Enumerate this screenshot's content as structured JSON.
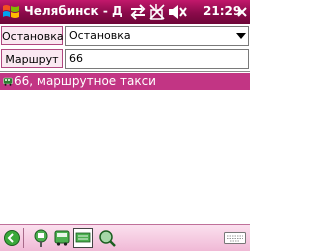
{
  "window": {
    "title": "Челябинск - Д",
    "clock": "21:29",
    "accent_color": "#a3105a",
    "selection_color": "#c23584"
  },
  "tray": {
    "icons": [
      "sync-icon",
      "signal-off-icon",
      "volume-muted-icon"
    ]
  },
  "form": {
    "stop_label": "Остановка",
    "stop_value": "Остановка",
    "route_label": "Маршрут",
    "route_value": "66"
  },
  "results": [
    {
      "text": "66, маршрутное такси",
      "icon": "minibus-icon",
      "selected": true
    }
  ],
  "toolbar": {
    "buttons": [
      "back-icon",
      "bus-stop-icon",
      "bus-icon",
      "keyboard-route-icon",
      "search-icon"
    ],
    "input_panel_icon": "keyboard-icon"
  }
}
